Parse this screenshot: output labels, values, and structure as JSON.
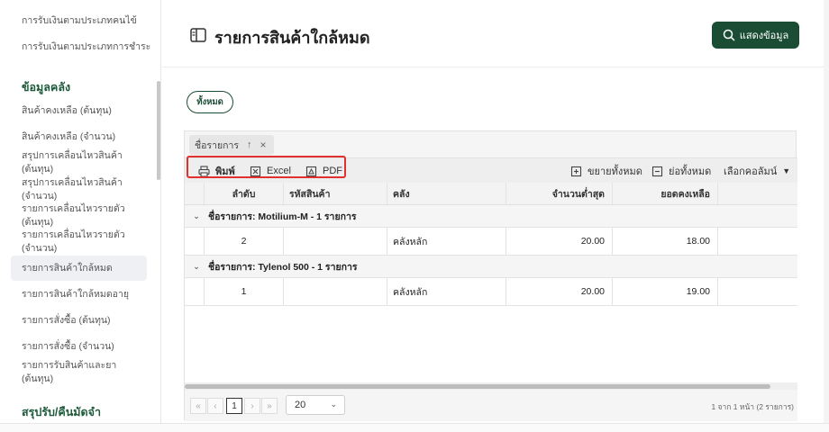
{
  "sidebar": {
    "items_top": [
      {
        "label": "การรับเงินตามประเภทคนไข้"
      },
      {
        "label": "การรับเงินตามประเภทการชำระ"
      }
    ],
    "section_inventory": "ข้อมูลคลัง",
    "items": [
      {
        "label": "สินค้าคงเหลือ (ต้นทุน)"
      },
      {
        "label": "สินค้าคงเหลือ (จำนวน)"
      },
      {
        "label": "สรุปการเคลื่อนไหวสินค้า (ต้นทุน)"
      },
      {
        "label": "สรุปการเคลื่อนไหวสินค้า (จำนวน)"
      },
      {
        "label": "รายการเคลื่อนไหวรายตัว (ต้นทุน)"
      },
      {
        "label": "รายการเคลื่อนไหวรายตัว (จำนวน)"
      },
      {
        "label": "รายการสินค้าใกล้หมด"
      },
      {
        "label": "รายการสินค้าใกล้หมดอายุ"
      },
      {
        "label": "รายการสั่งซื้อ (ต้นทุน)"
      },
      {
        "label": "รายการสั่งซื้อ (จำนวน)"
      },
      {
        "label": "รายการรับสินค้าและยา (ต้นทุน)"
      }
    ],
    "section_summary": "สรุปรับ/คืนมัดจำ"
  },
  "header": {
    "title": "รายการสินค้าใกล้หมด",
    "show_button": "แสดงข้อมูล"
  },
  "filter_chip": "ทั้งหมด",
  "grouping": {
    "label": "ชื่อรายการ"
  },
  "toolbar": {
    "print": "พิมพ์",
    "excel": "Excel",
    "pdf": "PDF",
    "expand_all": "ขยายทั้งหมด",
    "collapse_all": "ย่อทั้งหมด",
    "choose_columns": "เลือกคอลัมน์"
  },
  "table": {
    "columns": [
      "ลำดับ",
      "รหัสสินค้า",
      "คลัง",
      "จำนวนต่ำสุด",
      "ยอดคงเหลือ"
    ],
    "groups": [
      {
        "title": "ชื่อรายการ: Motilium-M - 1 รายการ",
        "row": {
          "seq": "2",
          "code": "",
          "warehouse": "คลังหลัก",
          "min_qty": "20.00",
          "balance": "18.00"
        }
      },
      {
        "title": "ชื่อรายการ: Tylenol 500 - 1 รายการ",
        "row": {
          "seq": "1",
          "code": "",
          "warehouse": "คลังหลัก",
          "min_qty": "20.00",
          "balance": "19.00"
        }
      }
    ]
  },
  "pager": {
    "current_page": "1",
    "page_size": "20",
    "info": "1 จาก 1 หน้า (2 รายการ)"
  },
  "colors": {
    "accent": "#1b4d35",
    "highlight": "#e03030"
  }
}
